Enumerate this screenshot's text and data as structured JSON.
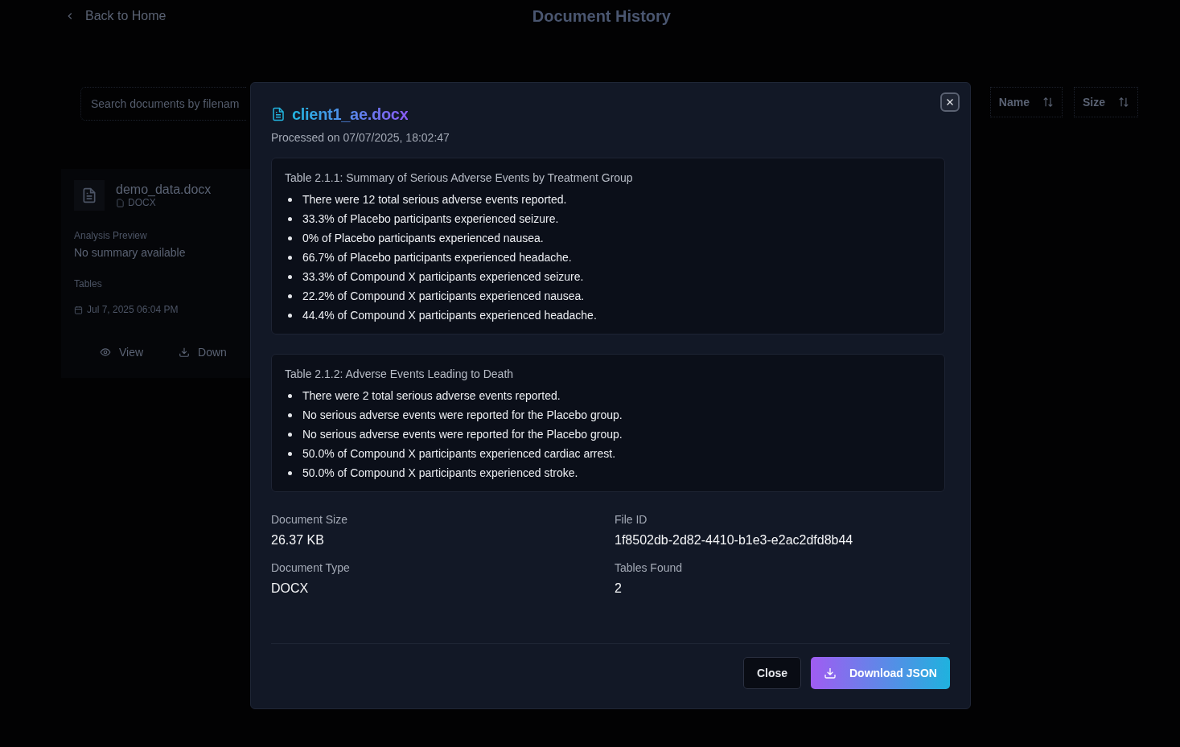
{
  "page": {
    "back_link": "Back to Home",
    "title": "Document History"
  },
  "toolbar": {
    "search_placeholder": "Search documents by filenam",
    "sort_buttons": [
      "Name",
      "Size"
    ]
  },
  "document_card": {
    "name": "demo_data.docx",
    "type": "DOCX",
    "preview_label": "Analysis Preview",
    "preview_text": "No summary available",
    "tables_label": "Tables",
    "date": "Jul 7, 2025 06:04 PM",
    "actions": [
      "View",
      "Down"
    ]
  },
  "dialog": {
    "title": "client1_ae.docx",
    "processed": "Processed on 07/07/2025, 18:02:47",
    "tables": [
      {
        "heading": "Table 2.1.1: Summary of Serious Adverse Events by Treatment Group",
        "items": [
          "There were 12 total serious adverse events reported.",
          "33.3% of Placebo participants experienced seizure.",
          "0% of Placebo participants experienced nausea.",
          "66.7% of Placebo participants experienced headache.",
          "33.3% of Compound X participants experienced seizure.",
          "22.2% of Compound X participants experienced nausea.",
          "44.4% of Compound X participants experienced headache."
        ]
      },
      {
        "heading": "Table 2.1.2: Adverse Events Leading to Death",
        "items": [
          "There were 2 total serious adverse events reported.",
          "No serious adverse events were reported for the Placebo group.",
          "No serious adverse events were reported for the Placebo group.",
          "50.0% of Compound X participants experienced cardiac arrest.",
          "50.0% of Compound X participants experienced stroke."
        ]
      }
    ],
    "details": [
      {
        "label": "Document Size",
        "value": "26.37 KB"
      },
      {
        "label": "File ID",
        "value": "1f8502db-2d82-4410-b1e3-e2ac2dfd8b44"
      },
      {
        "label": "Document Type",
        "value": "DOCX"
      },
      {
        "label": "Tables Found",
        "value": "2"
      }
    ],
    "buttons": [
      {
        "label": "Close",
        "kind": "secondary"
      },
      {
        "label": "Download JSON",
        "kind": "primary"
      }
    ]
  }
}
